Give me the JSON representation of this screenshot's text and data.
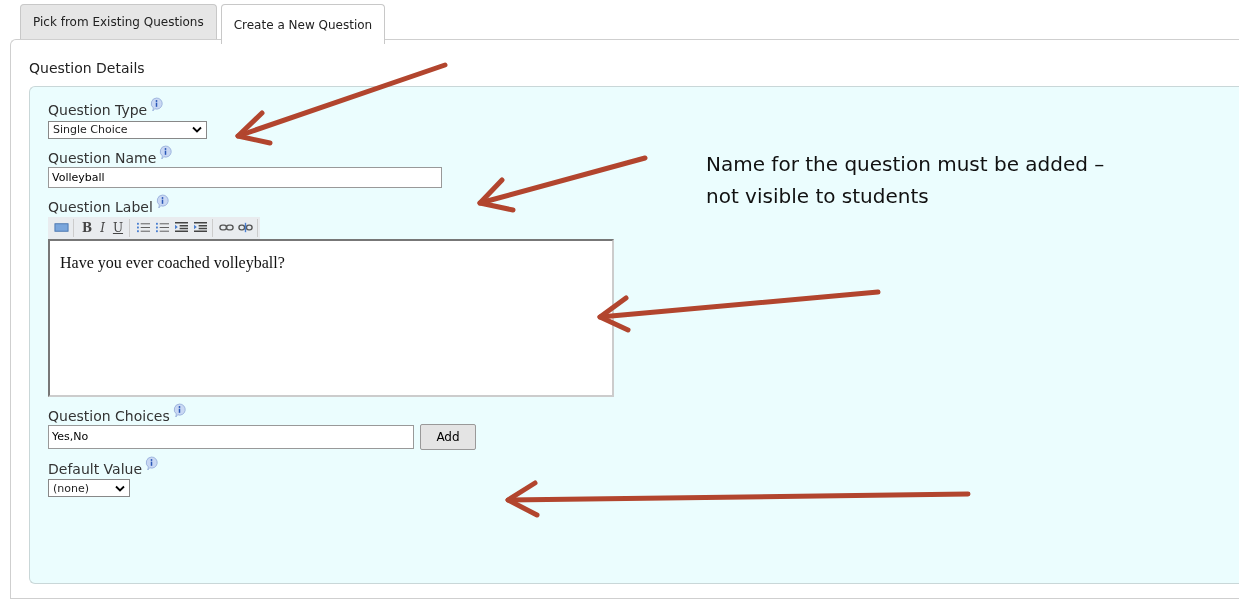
{
  "tabs": [
    {
      "label": "Pick from Existing Questions",
      "selected": false
    },
    {
      "label": "Create a New Question",
      "selected": true
    }
  ],
  "section_title": "Question Details",
  "fields": [
    {
      "kind": "select",
      "label": "Question Type",
      "value": "Single Choice"
    },
    {
      "kind": "text",
      "label": "Question Name",
      "value": "Volleyball"
    },
    {
      "kind": "richtext",
      "label": "Question Label",
      "value": "Have you ever coached volleyball?",
      "toolbar": [
        [
          {
            "kind": "image"
          }
        ],
        [
          {
            "kind": "bold",
            "label": "B"
          },
          {
            "kind": "italic",
            "label": "I"
          },
          {
            "kind": "underline",
            "label": "U"
          }
        ],
        [
          {
            "kind": "ordered"
          },
          {
            "kind": "bullets"
          },
          {
            "kind": "outdent"
          },
          {
            "kind": "indent"
          }
        ],
        [
          {
            "kind": "link"
          },
          {
            "kind": "unlink"
          }
        ]
      ]
    },
    {
      "kind": "choices",
      "label": "Question Choices",
      "value": "Yes,No",
      "button": "Add"
    },
    {
      "kind": "smallselect",
      "label": "Default Value",
      "value": "(none)"
    }
  ],
  "annotation": "Name for the question must be added – not visible to students"
}
